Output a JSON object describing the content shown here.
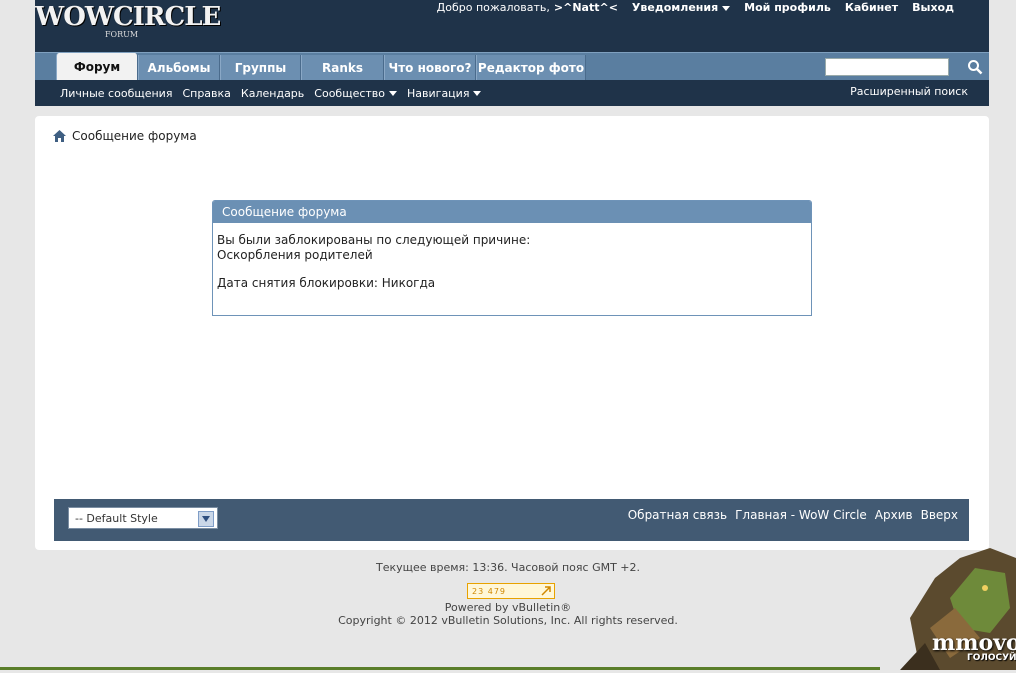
{
  "header": {
    "logo_main": "WOWCIRCLE",
    "logo_sub": "FORUM",
    "welcome_text": "Добро пожаловать,",
    "username": ">^Natt^<",
    "notifications": "Уведомления",
    "my_profile": "Мой профиль",
    "cabinet": "Кабинет",
    "logout": "Выход"
  },
  "tabs": [
    {
      "label": "Форум"
    },
    {
      "label": "Альбомы"
    },
    {
      "label": "Группы"
    },
    {
      "label": "Ranks"
    },
    {
      "label": "Что нового?"
    },
    {
      "label": "Редактор фото"
    }
  ],
  "search": {
    "value": "",
    "placeholder": ""
  },
  "subnav": {
    "items": [
      "Личные сообщения",
      "Справка",
      "Календарь",
      "Сообщество",
      "Навигация"
    ],
    "advanced_search": "Расширенный поиск"
  },
  "breadcrumb": {
    "title": "Сообщение форума"
  },
  "message": {
    "heading": "Сообщение форума",
    "line1": "Вы были заблокированы по следующей причине:",
    "line2": "Оскорбления родителей",
    "line3": "Дата снятия блокировки: Никогда"
  },
  "footer": {
    "style_select": "-- Default Style",
    "links": [
      "Обратная связь",
      "Главная - WoW Circle",
      "Архив",
      "Вверх"
    ]
  },
  "bottom": {
    "time": "Текущее время: 13:36. Часовой пояс GMT +2.",
    "counter": "23 479",
    "powered": "Powered by vBulletin®",
    "copyright": "Copyright © 2012 vBulletin Solutions, Inc. All rights reserved."
  },
  "banner": {
    "text1": "mmovote",
    "text2": "ГОЛОСУЙ"
  },
  "colors": {
    "header_bg": "#1f3349",
    "tab_bg": "#6c8fb1",
    "box_head": "#6b90b4",
    "footer_bg": "#425a73"
  }
}
